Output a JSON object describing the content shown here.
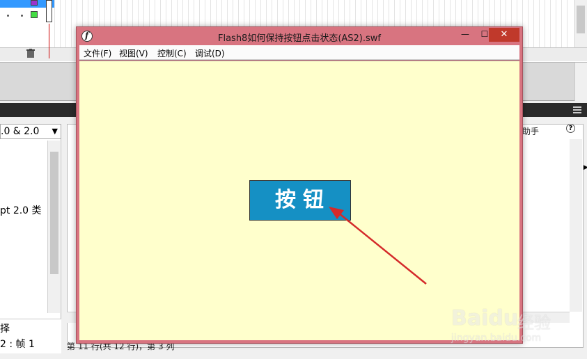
{
  "background_ide": {
    "version_select": ".0 & 2.0",
    "left_item": "pt 2.0 类",
    "left_bottom_label": "择",
    "left_frame_label": "2 : 帧 1",
    "helper_label": "助手",
    "help_icon": "?",
    "status_line": "第 11 行(共 12 行)，第 3 列"
  },
  "player": {
    "title": "Flash8如何保持按钮点击状态(AS2).swf",
    "icon": "f",
    "window_controls": {
      "minimize": "—",
      "maximize": "☐",
      "close": "✕"
    },
    "menu": [
      "文件(F)",
      "视图(V)",
      "控制(C)",
      "调试(D)"
    ],
    "button_label": "按钮"
  },
  "watermark": {
    "logo": "Baidu",
    "text": "经验",
    "url": "jingyan.baidu.com"
  },
  "colors": {
    "player_frame": "#d87480",
    "stage_bg": "#ffffcc",
    "button_bg": "#1590c4",
    "arrow": "#d42a2a"
  }
}
